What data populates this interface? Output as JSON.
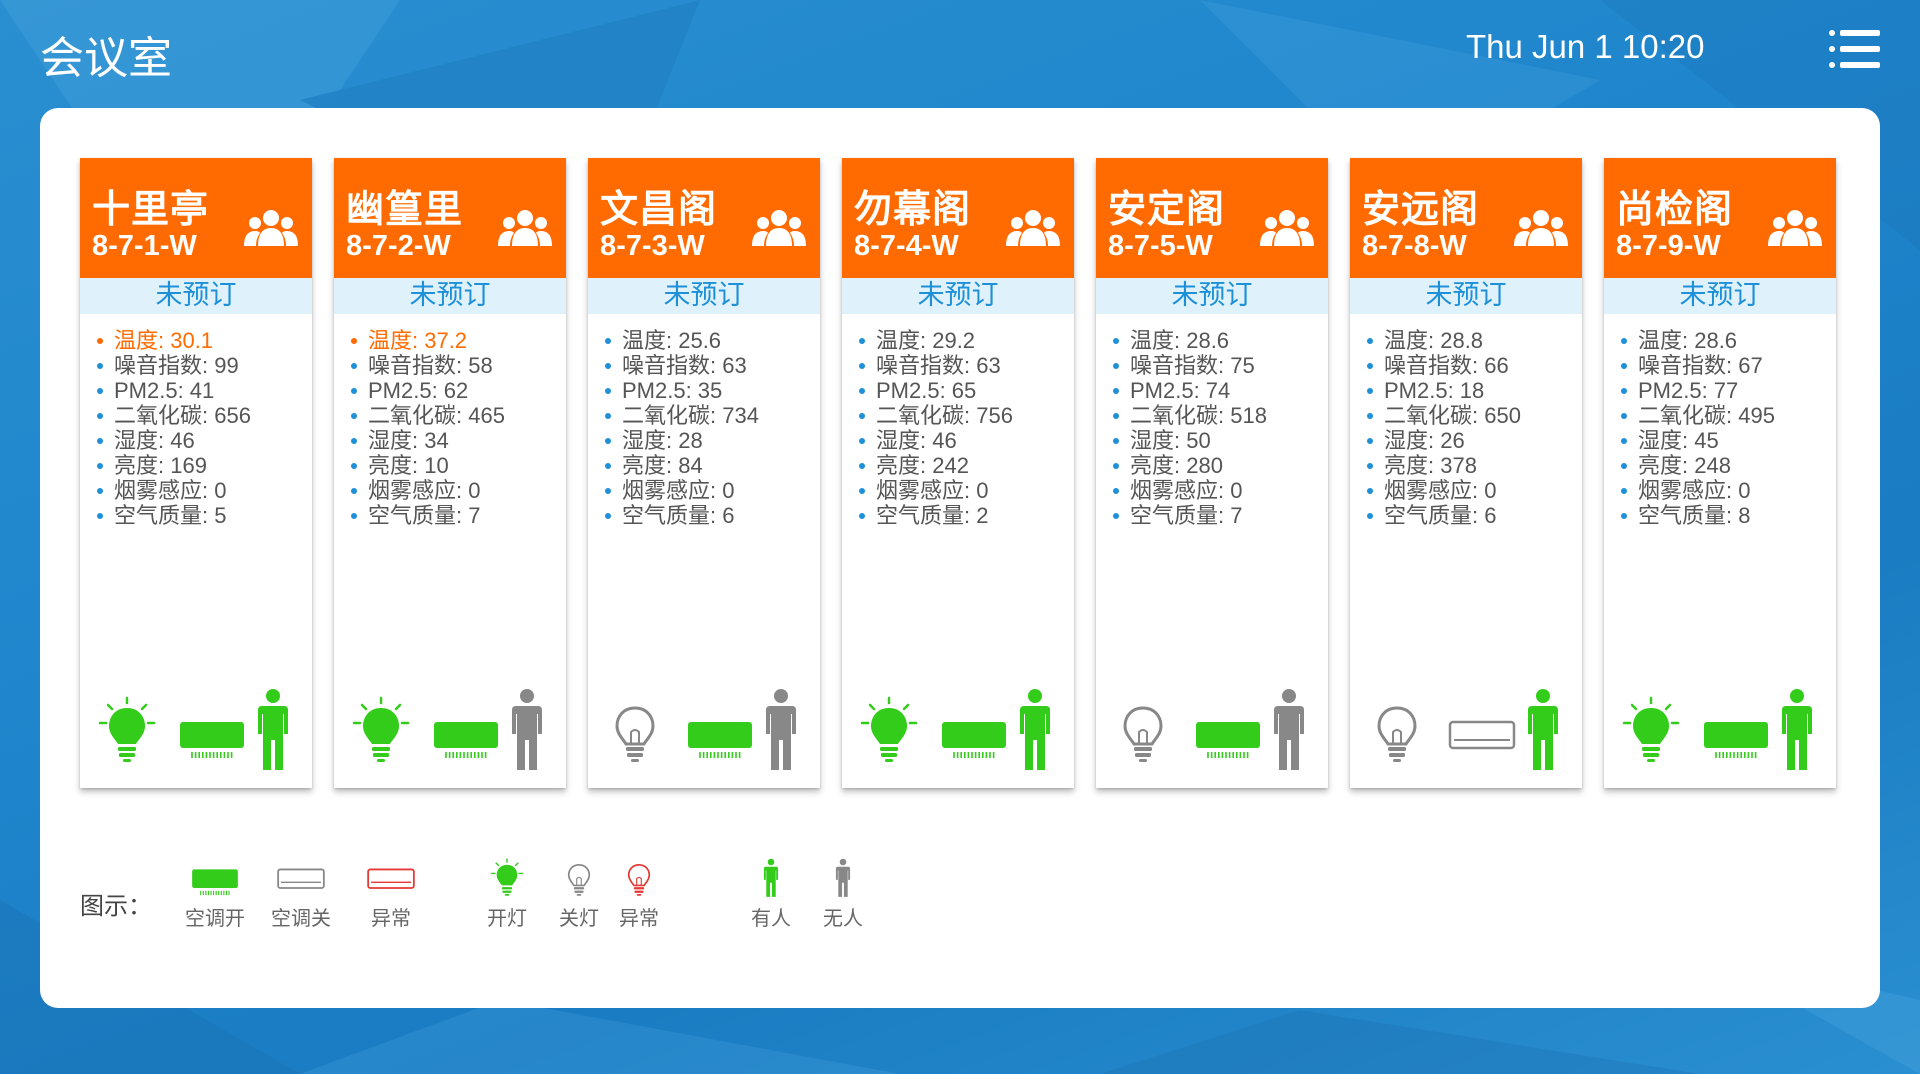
{
  "header": {
    "title": "会议室",
    "datetime": "Thu Jun 1 10:20",
    "menu_icon": "menu-icon"
  },
  "colors": {
    "accent": "#ff6b00",
    "on": "#33cc1a",
    "off": "#888888",
    "alarm": "#e53935",
    "booking": "#1e90d8"
  },
  "rooms": [
    {
      "name": "十里亭",
      "code": "8-7-1-W",
      "status": "未预订",
      "metrics": [
        "温度: 30.1",
        "噪音指数: 99",
        "PM2.5: 41",
        "二氧化碳: 656",
        "湿度: 46",
        "亮度: 169",
        "烟雾感应: 0",
        "空气质量: 5"
      ],
      "alert_index": 0,
      "light": "on",
      "ac": "on",
      "person": "present"
    },
    {
      "name": "幽篁里",
      "code": "8-7-2-W",
      "status": "未预订",
      "metrics": [
        "温度: 37.2",
        "噪音指数: 58",
        "PM2.5: 62",
        "二氧化碳: 465",
        "湿度: 34",
        "亮度: 10",
        "烟雾感应: 0",
        "空气质量: 7"
      ],
      "alert_index": 0,
      "light": "on",
      "ac": "on",
      "person": "absent"
    },
    {
      "name": "文昌阁",
      "code": "8-7-3-W",
      "status": "未预订",
      "metrics": [
        "温度: 25.6",
        "噪音指数: 63",
        "PM2.5: 35",
        "二氧化碳: 734",
        "湿度: 28",
        "亮度: 84",
        "烟雾感应: 0",
        "空气质量: 6"
      ],
      "alert_index": -1,
      "light": "off",
      "ac": "on",
      "person": "absent"
    },
    {
      "name": "勿幕阁",
      "code": "8-7-4-W",
      "status": "未预订",
      "metrics": [
        "温度: 29.2",
        "噪音指数: 63",
        "PM2.5: 65",
        "二氧化碳: 756",
        "湿度: 46",
        "亮度: 242",
        "烟雾感应: 0",
        "空气质量: 2"
      ],
      "alert_index": -1,
      "light": "on",
      "ac": "on",
      "person": "present"
    },
    {
      "name": "安定阁",
      "code": "8-7-5-W",
      "status": "未预订",
      "metrics": [
        "温度: 28.6",
        "噪音指数: 75",
        "PM2.5: 74",
        "二氧化碳: 518",
        "湿度: 50",
        "亮度: 280",
        "烟雾感应: 0",
        "空气质量: 7"
      ],
      "alert_index": -1,
      "light": "off",
      "ac": "on",
      "person": "absent"
    },
    {
      "name": "安远阁",
      "code": "8-7-8-W",
      "status": "未预订",
      "metrics": [
        "温度: 28.8",
        "噪音指数: 66",
        "PM2.5: 18",
        "二氧化碳: 650",
        "湿度: 26",
        "亮度: 378",
        "烟雾感应: 0",
        "空气质量: 6"
      ],
      "alert_index": -1,
      "light": "off",
      "ac": "off",
      "person": "present"
    },
    {
      "name": "尚检阁",
      "code": "8-7-9-W",
      "status": "未预订",
      "metrics": [
        "温度: 28.6",
        "噪音指数: 67",
        "PM2.5: 77",
        "二氧化碳: 495",
        "湿度: 45",
        "亮度: 248",
        "烟雾感应: 0",
        "空气质量: 8"
      ],
      "alert_index": -1,
      "light": "on",
      "ac": "on",
      "person": "present"
    }
  ],
  "legend": {
    "title": "图示：",
    "items": [
      {
        "kind": "ac",
        "state": "on",
        "label": "空调开"
      },
      {
        "kind": "ac",
        "state": "off",
        "label": "空调关"
      },
      {
        "kind": "ac",
        "state": "alarm",
        "label": "异常"
      },
      {
        "kind": "light",
        "state": "on",
        "label": "开灯"
      },
      {
        "kind": "light",
        "state": "off",
        "label": "关灯"
      },
      {
        "kind": "light",
        "state": "alarm",
        "label": "异常"
      },
      {
        "kind": "person",
        "state": "present",
        "label": "有人"
      },
      {
        "kind": "person",
        "state": "absent",
        "label": "无人"
      }
    ]
  }
}
